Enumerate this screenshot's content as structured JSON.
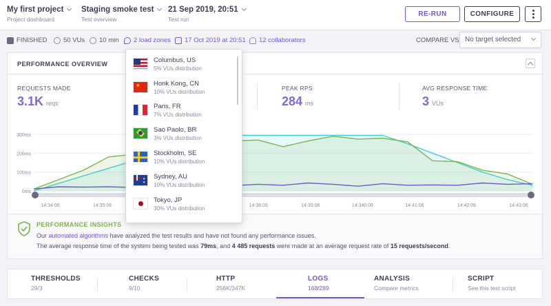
{
  "header": {
    "project": {
      "title": "My first project",
      "subtitle": "Project dashboard"
    },
    "test": {
      "title": "Staging smoke test",
      "subtitle": "Test overview"
    },
    "run": {
      "title": "21 Sep 2019, 20:51",
      "subtitle": "Test run"
    },
    "rerun_label": "RE-RUN",
    "configure_label": "CONFIGURE"
  },
  "status": {
    "state": "FINISHED",
    "vus": "50 VUs",
    "duration": "10 min",
    "zones": "2 load zones",
    "date": "17 Oct 2019 at 20:51",
    "collaborators": "12  collaborators",
    "compare_label": "COMPARE VS:",
    "compare_value": "No target selected"
  },
  "overview": {
    "title": "PERFORMANCE OVERVIEW",
    "metrics": [
      {
        "label": "REQUESTS MADE",
        "value": "3.1K",
        "unit": "reqs"
      },
      {
        "label": "PEAK RPS",
        "value": "284",
        "unit": "ms"
      },
      {
        "label": "AVG RESPONSE TIME",
        "value": "3",
        "unit": "VUs"
      }
    ]
  },
  "chart_data": {
    "type": "line",
    "y_ticks": [
      "300ms",
      "200ms",
      "100ms",
      "0ms"
    ],
    "ylim": [
      0,
      300
    ],
    "x_ticks": [
      "14:34:06",
      "14:35:06",
      "14:36:06",
      "14:37:06",
      "14:38:06",
      "14:39:06",
      "14:340:06",
      "14:41:06",
      "14:42:06",
      "14:43:06"
    ],
    "series": [
      {
        "color": "#3fcfd8",
        "values": [
          0,
          40,
          80,
          120,
          160,
          200,
          295,
          295,
          295,
          295,
          295,
          295,
          295,
          295,
          295,
          250,
          200,
          150,
          100,
          60,
          30
        ]
      },
      {
        "color": "#79b64b",
        "values": [
          10,
          60,
          110,
          180,
          195,
          250,
          265,
          250,
          265,
          270,
          235,
          265,
          290,
          275,
          280,
          260,
          160,
          155,
          110,
          90,
          35
        ]
      },
      {
        "color": "#6b5bd0",
        "values": [
          10,
          22,
          20,
          22,
          18,
          40,
          42,
          30,
          28,
          35,
          30,
          42,
          35,
          25,
          38,
          30,
          32,
          30,
          42,
          35,
          38
        ]
      }
    ]
  },
  "load_zones": [
    {
      "name": "Columbus, US",
      "dist": "5% VUs distribution",
      "flag": "us"
    },
    {
      "name": "Honk Kong, CN",
      "dist": "10% VUs distribution",
      "flag": "cn"
    },
    {
      "name": "Paris, FR",
      "dist": "7% VUs distribution",
      "flag": "fr"
    },
    {
      "name": "Sao Paolo, BR",
      "dist": "3% VUs distribution",
      "flag": "br"
    },
    {
      "name": "Stockholm, SE",
      "dist": "10% VUs distribution",
      "flag": "se"
    },
    {
      "name": "Sydney, AU",
      "dist": "10% VUs distribution",
      "flag": "au"
    },
    {
      "name": "Tokyo, JP",
      "dist": "30% VUs distribution",
      "flag": "jp"
    }
  ],
  "insights": {
    "title": "PERFORMANCE INSIGHTS",
    "line1_pre": "Our ",
    "line1_link": "automated algorithms",
    "line1_post": " have analyzed the test results and have not found any performance issues.",
    "line2_a": "The average response time of the system being tested was ",
    "line2_b": "79ms",
    "line2_c": ", and ",
    "line2_d": "4 485 requests",
    "line2_e": " were made at an average request rate of ",
    "line2_f": "15 requests/second",
    "line2_g": "."
  },
  "tabs": [
    {
      "label": "THRESHOLDS",
      "sub": "29/3"
    },
    {
      "label": "CHECKS",
      "sub": "9/10"
    },
    {
      "label": "HTTP",
      "sub": "256K/347K"
    },
    {
      "label": "LOGS",
      "sub": "168/289"
    },
    {
      "label": "ANALYSIS",
      "sub": "Compare metrics"
    },
    {
      "label": "SCRIPT",
      "sub": "See this test script"
    }
  ]
}
